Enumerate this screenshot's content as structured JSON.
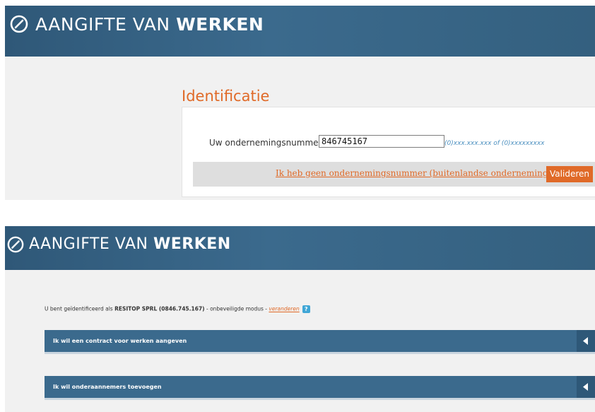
{
  "colors": {
    "header_bg": "#3b6a8d",
    "accent": "#e06a28",
    "hint": "#4b8fbf",
    "help": "#3fa6d6"
  },
  "brand": {
    "light": "AANGIFTE VAN ",
    "bold": "WERKEN",
    "icon": "logo-circle-slash-icon"
  },
  "identification": {
    "title": "Identificatie",
    "company_number_label": "Uw ondernemingsnummer",
    "company_number_value": "846745167",
    "format_hint": "(0)xxx.xxx.xxx of (0)xxxxxxxxx",
    "no_number_link": "Ik heb geen ondernemingsnummer (buitenlandse onderneming)",
    "validate_button": "Valideren"
  },
  "session": {
    "prefix": "U bent geïdentificeerd als ",
    "company": "RESITOP SPRL (0846.745.167)",
    "middle": " - onbeveiligde modus - ",
    "change_link": "veranderen",
    "help_icon": "?"
  },
  "sections": [
    {
      "label": "Ik wil een contract voor werken aangeven",
      "icon": "triangle-left-icon"
    },
    {
      "label": "Ik wil onderaannemers toevoegen",
      "icon": "triangle-left-icon"
    }
  ]
}
